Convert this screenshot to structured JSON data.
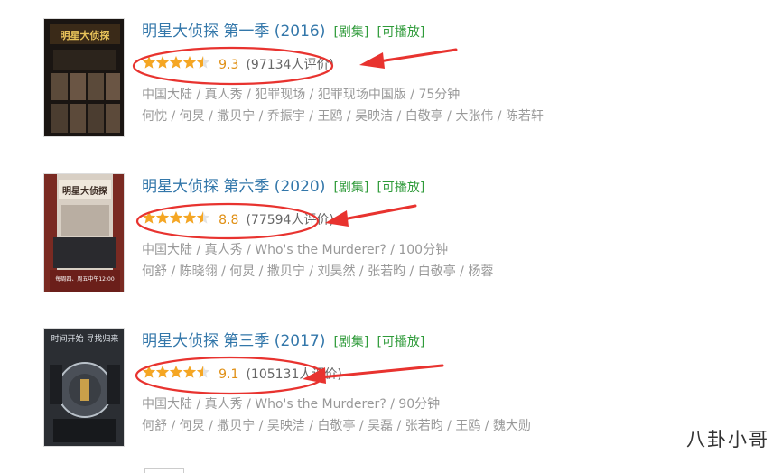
{
  "results": [
    {
      "title": "明星大侦探 第一季 (2016)",
      "tag_series": "[剧集]",
      "tag_play": "[可播放]",
      "rating": 9.3,
      "rating_text": "9.3",
      "votes_text": "(97134人评价)",
      "meta_line1": "中国大陆 / 真人秀 / 犯罪现场 / 犯罪现场中国版 / 75分钟",
      "meta_line2": "何忱 / 何炅 / 撒贝宁 / 乔振宇 / 王鸥 / 吴映洁 / 白敬亭 / 大张伟 / 陈若轩",
      "poster_colors": {
        "bg": "#1a1512",
        "accent": "#c9a04a"
      },
      "poster_text": "明星大侦探"
    },
    {
      "title": "明星大侦探 第六季 (2020)",
      "tag_series": "[剧集]",
      "tag_play": "[可播放]",
      "rating": 8.8,
      "rating_text": "8.8",
      "votes_text": "(77594人评价)",
      "meta_line1": "中国大陆 / 真人秀 / Who's the Murderer? / 100分钟",
      "meta_line2": "何舒 / 陈晓翎 / 何炅 / 撒贝宁 / 刘昊然 / 张若昀 / 白敬亭 / 杨蓉",
      "poster_colors": {
        "bg": "#d8cfc4",
        "accent": "#7a2a22"
      },
      "poster_text": "明星大侦探",
      "poster_caption": "每周四、周五中午12:00"
    },
    {
      "title": "明星大侦探 第三季 (2017)",
      "tag_series": "[剧集]",
      "tag_play": "[可播放]",
      "rating": 9.1,
      "rating_text": "9.1",
      "votes_text": "(105131人评价)",
      "meta_line1": "中国大陆 / 真人秀 / Who's the Murderer? / 90分钟",
      "meta_line2": "何舒 / 何炅 / 撒贝宁 / 吴映洁 / 白敬亭 / 吴磊 / 张若昀 / 王鸥 / 魏大勋",
      "poster_colors": {
        "bg": "#2b2e33",
        "accent": "#b8c0c8"
      },
      "poster_text": "时间开始 寻找归来"
    }
  ],
  "stars": 4.5,
  "colors": {
    "title": "#3377aa",
    "tag": "#2f9b3a",
    "score": "#e09015",
    "star": "#f5a623",
    "meta": "#999999",
    "annotation": "#e8332f"
  },
  "watermark": "八卦小哥"
}
